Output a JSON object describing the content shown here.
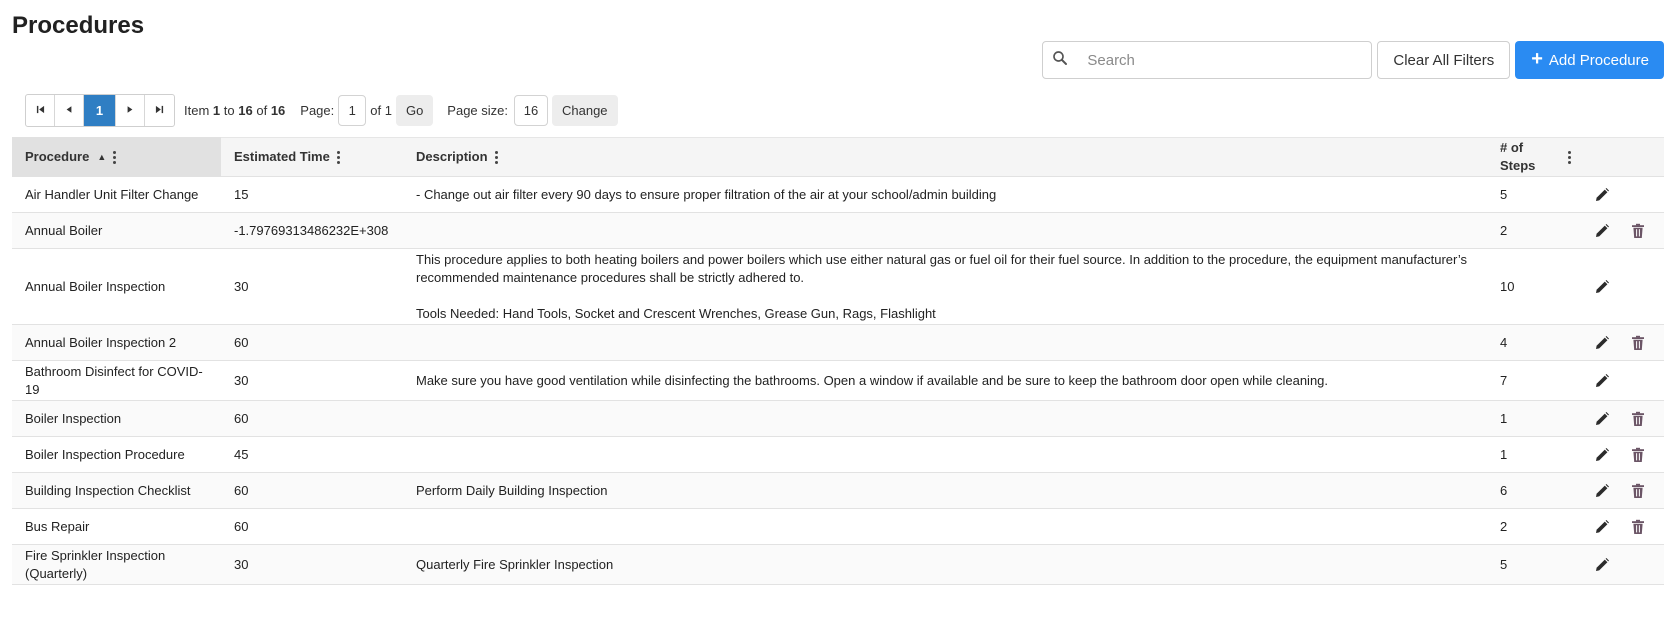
{
  "page": {
    "title": "Procedures"
  },
  "toolbar": {
    "search_placeholder": "Search",
    "clear_label": "Clear All Filters",
    "add_label": "Add Procedure"
  },
  "pager": {
    "current_page": "1",
    "item_prefix": "Item",
    "item_from": "1",
    "item_to_word": "to",
    "item_to": "16",
    "item_of_word": "of",
    "item_total": "16",
    "page_label": "Page:",
    "page_value": "1",
    "of_pages": "of 1",
    "go_label": "Go",
    "size_label": "Page size:",
    "size_value": "16",
    "change_label": "Change"
  },
  "columns": {
    "procedure": "Procedure",
    "time": "Estimated Time",
    "description": "Description",
    "steps": "# of Steps"
  },
  "rows": [
    {
      "procedure": "Air Handler Unit Filter Change",
      "time": "15",
      "description": [
        "- Change out air filter every 90 days to ensure proper filtration of the air at your school/admin building"
      ],
      "steps": "5",
      "deletable": false
    },
    {
      "procedure": "Annual Boiler",
      "time": "-1.79769313486232E+308",
      "description": [],
      "steps": "2",
      "deletable": true
    },
    {
      "procedure": "Annual Boiler Inspection",
      "time": "30",
      "description": [
        "This procedure applies to both heating boilers and power boilers which use either natural gas or fuel oil for their fuel source. In addition to the procedure, the equipment manufacturer’s recommended maintenance procedures shall be strictly adhered to.",
        "Tools Needed: Hand Tools, Socket and Crescent Wrenches, Grease Gun, Rags, Flashlight"
      ],
      "steps": "10",
      "deletable": false
    },
    {
      "procedure": "Annual Boiler Inspection 2",
      "time": "60",
      "description": [],
      "steps": "4",
      "deletable": true
    },
    {
      "procedure": "Bathroom Disinfect for COVID-19",
      "time": "30",
      "description": [
        "Make sure you have good ventilation while disinfecting the bathrooms. Open a window if available and be sure to keep the bathroom door open while cleaning."
      ],
      "steps": "7",
      "deletable": false
    },
    {
      "procedure": "Boiler Inspection",
      "time": "60",
      "description": [],
      "steps": "1",
      "deletable": true
    },
    {
      "procedure": "Boiler Inspection Procedure",
      "time": "45",
      "description": [],
      "steps": "1",
      "deletable": true
    },
    {
      "procedure": "Building Inspection Checklist",
      "time": "60",
      "description": [
        "Perform Daily Building Inspection"
      ],
      "steps": "6",
      "deletable": true
    },
    {
      "procedure": "Bus Repair",
      "time": "60",
      "description": [],
      "steps": "2",
      "deletable": true
    },
    {
      "procedure": "Fire Sprinkler Inspection (Quarterly)",
      "time": "30",
      "description": [
        "Quarterly Fire Sprinkler Inspection"
      ],
      "steps": "5",
      "deletable": false
    }
  ],
  "colors": {
    "accent": "#2a8bf2",
    "active_page": "#2f7ec3",
    "delete_icon": "#6b5566"
  }
}
